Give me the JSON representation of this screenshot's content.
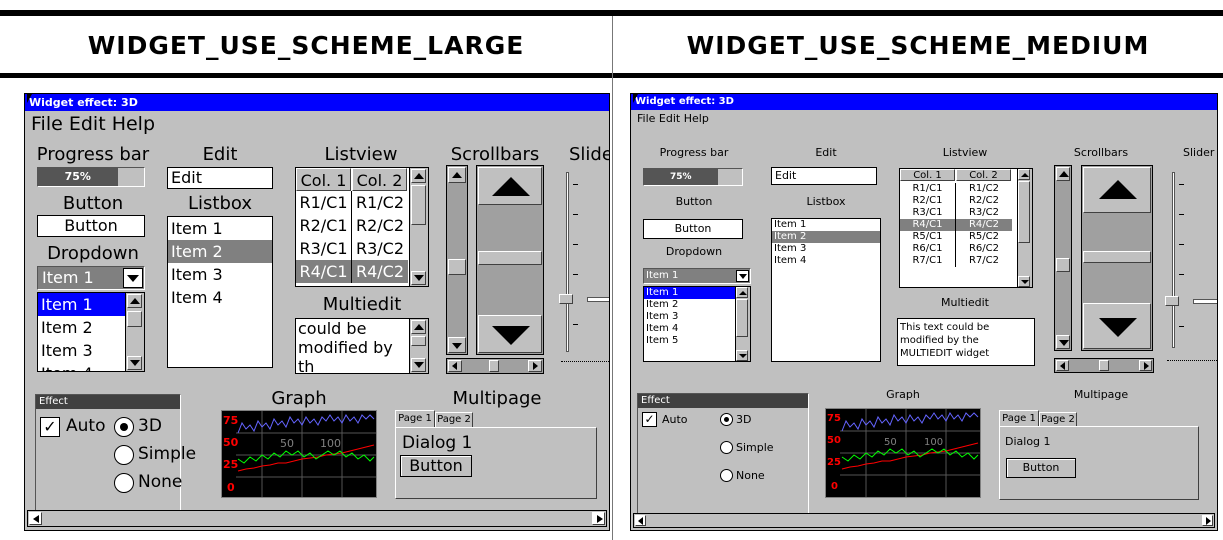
{
  "headings": {
    "left": "WIDGET_USE_SCHEME_LARGE",
    "right": "WIDGET_USE_SCHEME_MEDIUM"
  },
  "window": {
    "title": "Widget effect: 3D",
    "menu": [
      "File",
      "Edit",
      "Help"
    ]
  },
  "labels": {
    "progress": "Progress bar",
    "edit": "Edit",
    "listview": "Listview",
    "scrollbars": "Scrollbars",
    "slider": "Slider",
    "button": "Button",
    "listbox": "Listbox",
    "dropdown": "Dropdown",
    "multiedit": "Multiedit",
    "graph": "Graph",
    "multipage": "Multipage",
    "effect": "Effect"
  },
  "progress": {
    "value": 0.75,
    "text": "75%"
  },
  "edit": {
    "value": "Edit"
  },
  "button_text": "Button",
  "listbox_items": [
    "Item 1",
    "Item 2",
    "Item 3",
    "Item 4"
  ],
  "listbox_selected": 1,
  "dropdown": {
    "value": "Item 1",
    "items": [
      "Item 1",
      "Item 2",
      "Item 3",
      "Item 4",
      "Item 5"
    ],
    "selected": 0
  },
  "listview": {
    "columns": [
      "Col. 1",
      "Col. 2"
    ],
    "rows": [
      [
        "R1/C1",
        "R1/C2"
      ],
      [
        "R2/C1",
        "R2/C2"
      ],
      [
        "R3/C1",
        "R3/C2"
      ],
      [
        "R4/C1",
        "R4/C2"
      ],
      [
        "R5/C1",
        "R5/C2"
      ],
      [
        "R6/C1",
        "R6/C2"
      ],
      [
        "R7/C1",
        "R7/C2"
      ]
    ],
    "selected": 3
  },
  "multiedit": {
    "large_lines": [
      "could be",
      "modified by",
      "th"
    ],
    "medium_lines": [
      "This text could be",
      "modified by the",
      "MULTIEDIT widget"
    ]
  },
  "effect": {
    "auto": "Auto",
    "auto_checked": true,
    "options": [
      "3D",
      "Simple",
      "None"
    ],
    "selected": 0
  },
  "graph": {
    "y_ticks": [
      "75",
      "50",
      "25",
      "0"
    ],
    "colors": {
      "series_a": "#6464ff",
      "series_b": "#ff0000",
      "series_c": "#00ff00"
    },
    "overlay_left": "50",
    "overlay_right": "100"
  },
  "multipage": {
    "tabs": [
      "Page 1",
      "Page 2"
    ],
    "dialog": "Dialog 1",
    "button": "Button"
  }
}
